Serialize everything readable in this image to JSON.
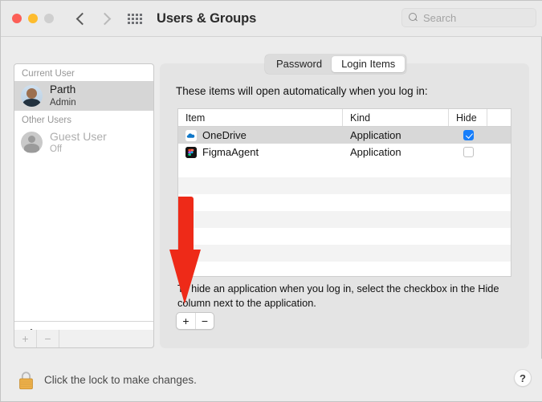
{
  "window": {
    "title": "Users & Groups",
    "traffic_lights": [
      "close",
      "minimize",
      "zoom"
    ],
    "back_icon": "chevron-left-icon",
    "forward_icon": "chevron-right-icon",
    "grid_icon": "show-all-grid-icon"
  },
  "search": {
    "placeholder": "Search",
    "icon": "search-icon"
  },
  "sidebar": {
    "groups": [
      {
        "header": "Current User",
        "users": [
          {
            "name": "Parth",
            "role": "Admin",
            "selected": true,
            "avatar": "user-photo-avatar"
          }
        ]
      },
      {
        "header": "Other Users",
        "users": [
          {
            "name": "Guest User",
            "role": "Off",
            "selected": false,
            "avatar": "guest-silhouette-avatar"
          }
        ]
      }
    ],
    "login_options": {
      "label": "Login Options",
      "icon": "house-icon"
    },
    "toolbar": {
      "add": "+",
      "remove": "−"
    }
  },
  "panel": {
    "tabs": [
      {
        "label": "Password",
        "active": false
      },
      {
        "label": "Login Items",
        "active": true
      }
    ],
    "description": "These items will open automatically when you log in:",
    "table": {
      "columns": [
        "Item",
        "Kind",
        "Hide"
      ],
      "rows": [
        {
          "item": "OneDrive",
          "kind": "Application",
          "hide": true,
          "selected": true,
          "icon": "onedrive-cloud-icon"
        },
        {
          "item": "FigmaAgent",
          "kind": "Application",
          "hide": false,
          "selected": false,
          "icon": "figma-icon"
        }
      ],
      "empty_row_count": 8
    },
    "hint": "To hide an application when you log in, select the checkbox in the Hide column next to the application.",
    "add_remove": {
      "add": "+",
      "remove": "−"
    }
  },
  "bottom": {
    "lock_icon": "closed-padlock-icon",
    "lock_text": "Click the lock to make changes.",
    "help_label": "?"
  },
  "annotation": {
    "arrow": "red-down-arrow",
    "color": "#ee2a18"
  },
  "colors": {
    "accent": "#167efb",
    "annotation_red": "#ee2a18",
    "window_bg": "#ececec",
    "panel_bg": "#e4e4e4"
  }
}
